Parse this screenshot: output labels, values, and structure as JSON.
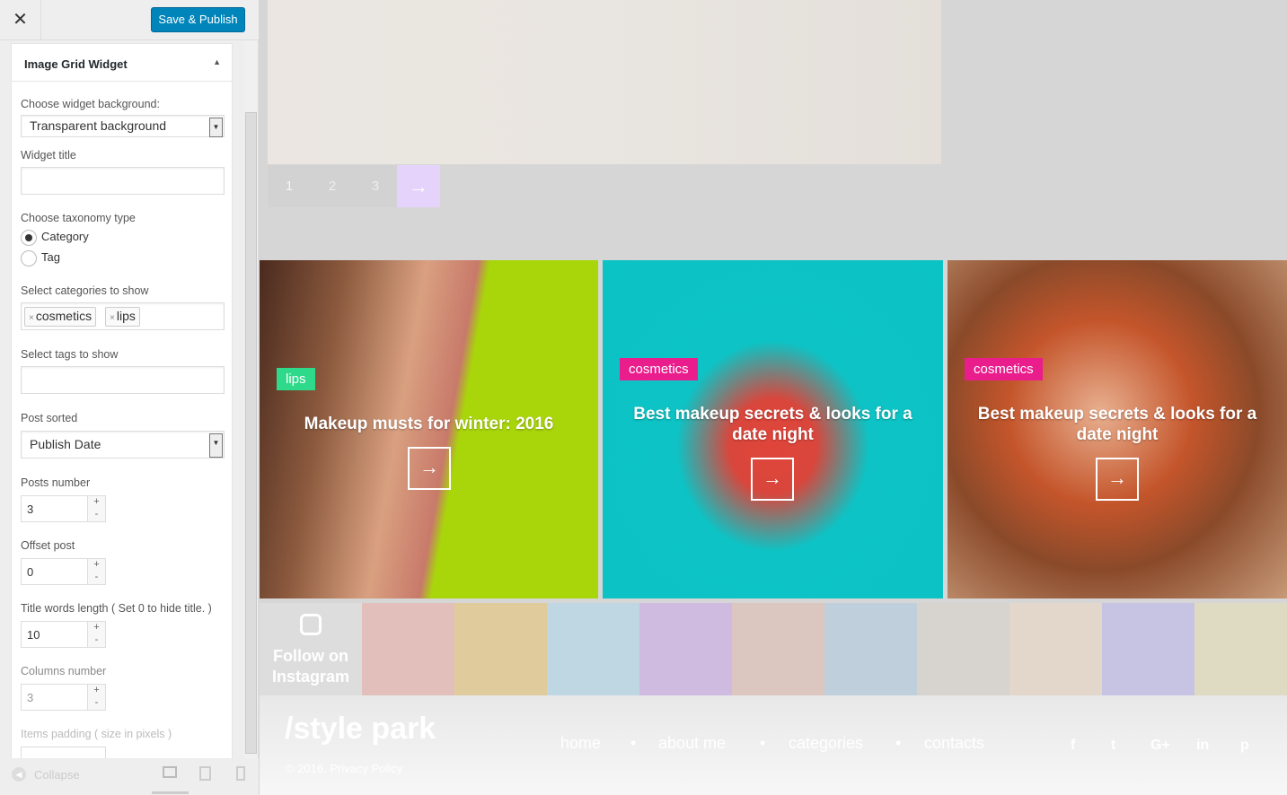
{
  "header": {
    "close_icon": "close-icon",
    "save_label": "Save & Publish"
  },
  "widget": {
    "title": "Image Grid Widget",
    "background_label": "Choose widget background:",
    "background_value": "Transparent background",
    "widget_title_label": "Widget title",
    "widget_title_value": "",
    "taxonomy_label": "Choose taxonomy type",
    "taxonomy_options": [
      "Category",
      "Tag"
    ],
    "taxonomy_selected": "Category",
    "categories_label": "Select categories to show",
    "categories": [
      "cosmetics",
      "lips"
    ],
    "tags_label": "Select tags to show",
    "sorted_label": "Post sorted",
    "sorted_value": "Publish Date",
    "posts_number_label": "Posts number",
    "posts_number": "3",
    "offset_label": "Offset post",
    "offset": "0",
    "title_words_label": "Title words length ( Set 0 to hide title. )",
    "title_words": "10",
    "columns_label": "Columns number",
    "columns": "3",
    "padding_label": "Items padding ( size in pixels )"
  },
  "sidebar_footer": {
    "collapse_label": "Collapse",
    "devices": [
      "desktop-icon",
      "tablet-icon",
      "mobile-icon"
    ]
  },
  "preview": {
    "pagination": [
      "1",
      "2",
      "3"
    ],
    "pagination_active_color": "#e6d3fb",
    "cards": [
      {
        "badge": "lips",
        "badge_color": "#2fd98a",
        "title": "Makeup musts for winter: 2016"
      },
      {
        "badge": "cosmetics",
        "badge_color": "#e91e8c",
        "title": "Best makeup secrets & looks for a date night"
      },
      {
        "badge": "cosmetics",
        "badge_color": "#e91e8c",
        "title": "Best makeup secrets & looks for a date night"
      }
    ],
    "instagram_label": "Follow on Instagram",
    "footer": {
      "logo": "/style park",
      "copyright": "© 2016. Privacy Policy",
      "nav": [
        "home",
        "about me",
        "categories",
        "contacts"
      ],
      "social": [
        "f",
        "t",
        "G+",
        "in",
        "p"
      ]
    }
  }
}
